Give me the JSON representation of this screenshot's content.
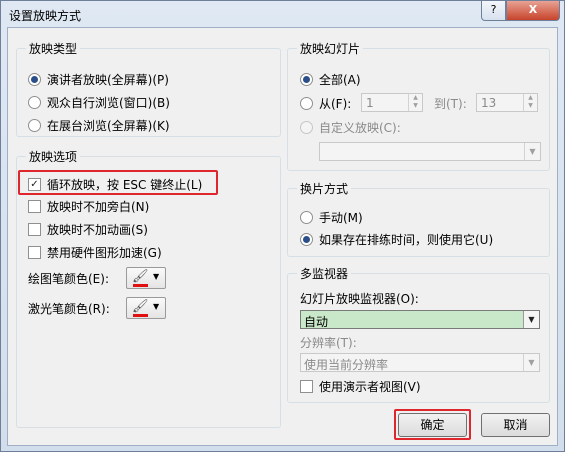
{
  "window": {
    "title": "设置放映方式",
    "help": "?",
    "close": "X"
  },
  "show_type": {
    "title": "放映类型",
    "options": [
      "演讲者放映(全屏幕)(P)",
      "观众自行浏览(窗口)(B)",
      "在展台浏览(全屏幕)(K)"
    ],
    "selected": 0
  },
  "show_slides": {
    "title": "放映幻灯片",
    "all_label": "全部(A)",
    "from_label": "从(F):",
    "from_value": "1",
    "to_label": "到(T):",
    "to_value": "13",
    "custom_label": "自定义放映(C):",
    "custom_value": ""
  },
  "show_options": {
    "title": "放映选项",
    "loop": "循环放映，按 ESC 键终止(L)",
    "no_narration": "放映时不加旁白(N)",
    "no_animation": "放映时不加动画(S)",
    "disable_hw": "禁用硬件图形加速(G)",
    "pen_color_label": "绘图笔颜色(E):",
    "laser_color_label": "激光笔颜色(R):"
  },
  "advance": {
    "title": "换片方式",
    "manual": "手动(M)",
    "timings": "如果存在排练时间，则使用它(U)"
  },
  "monitors": {
    "title": "多监视器",
    "monitor_label": "幻灯片放映监视器(O):",
    "monitor_value": "自动",
    "resolution_label": "分辨率(T):",
    "resolution_value": "使用当前分辨率",
    "presenter_view": "使用演示者视图(V)"
  },
  "buttons": {
    "ok": "确定",
    "cancel": "取消"
  },
  "colors": {
    "pen": "#e01010",
    "highlight": "#e0262d",
    "monitor_bg": "#c9e7c9"
  }
}
